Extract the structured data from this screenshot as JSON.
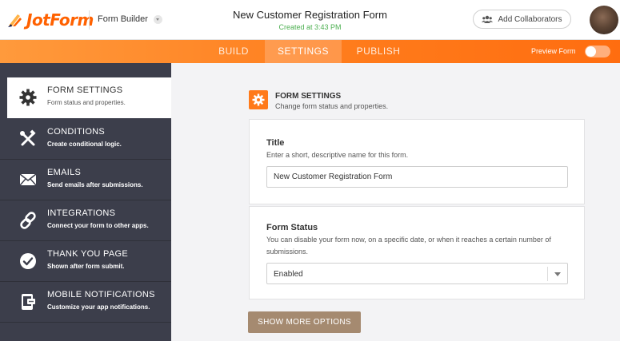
{
  "header": {
    "logo_text": "JotForm",
    "app_switcher_label": "Form Builder",
    "form_title": "New Customer Registration Form",
    "created_text": "Created at 3:43 PM",
    "collaborators_label": "Add Collaborators"
  },
  "nav": {
    "tabs": [
      {
        "label": "BUILD",
        "active": false
      },
      {
        "label": "SETTINGS",
        "active": true
      },
      {
        "label": "PUBLISH",
        "active": false
      }
    ],
    "preview_label": "Preview Form",
    "preview_enabled": false
  },
  "sidebar": {
    "items": [
      {
        "title": "FORM SETTINGS",
        "subtitle": "Form status and properties.",
        "icon": "gear-icon",
        "active": true
      },
      {
        "title": "CONDITIONS",
        "subtitle": "Create conditional logic.",
        "icon": "tools-icon",
        "active": false
      },
      {
        "title": "EMAILS",
        "subtitle": "Send emails after submissions.",
        "icon": "envelope-icon",
        "active": false
      },
      {
        "title": "INTEGRATIONS",
        "subtitle": "Connect your form to other apps.",
        "icon": "link-icon",
        "active": false
      },
      {
        "title": "THANK YOU PAGE",
        "subtitle": "Shown after form submit.",
        "icon": "check-circle-icon",
        "active": false
      },
      {
        "title": "MOBILE NOTIFICATIONS",
        "subtitle": "Customize your app notifications.",
        "icon": "mobile-notification-icon",
        "active": false
      }
    ]
  },
  "main": {
    "section_title": "FORM SETTINGS",
    "section_subtitle": "Change form status and properties.",
    "title_field": {
      "label": "Title",
      "description": "Enter a short, descriptive name for this form.",
      "value": "New Customer Registration Form"
    },
    "status_field": {
      "label": "Form Status",
      "description": "You can disable your form now, on a specific date, or when it reaches a certain number of submissions.",
      "value": "Enabled"
    },
    "more_options_label": "SHOW MORE OPTIONS"
  },
  "colors": {
    "brand_orange": "#ff7a1a",
    "sidebar_bg": "#3c3e4b",
    "button_brown": "#a58a70",
    "created_green": "#4caf50"
  }
}
